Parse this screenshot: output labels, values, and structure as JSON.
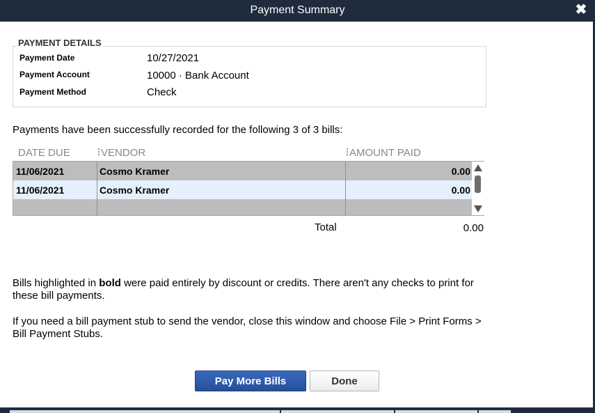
{
  "window": {
    "title": "Payment Summary",
    "close_glyph": "✖"
  },
  "details": {
    "section_title": "PAYMENT DETAILS",
    "rows": [
      {
        "label": "Payment Date",
        "value": "10/27/2021"
      },
      {
        "label": "Payment Account",
        "value": "10000 · Bank Account"
      },
      {
        "label": "Payment Method",
        "value": "Check"
      }
    ]
  },
  "message": "Payments have been successfully recorded for the following 3 of 3 bills:",
  "grid": {
    "headers": {
      "date_due": "DATE DUE",
      "vendor": "VENDOR",
      "amount_paid": "AMOUNT PAID"
    },
    "rows": [
      {
        "date_due": "11/06/2021",
        "vendor": "Cosmo Kramer",
        "amount_paid": "0.00"
      },
      {
        "date_due": "11/06/2021",
        "vendor": "Cosmo Kramer",
        "amount_paid": "0.00"
      }
    ]
  },
  "total": {
    "label": "Total",
    "value": "0.00"
  },
  "info": {
    "line1_prefix": "Bills highlighted in ",
    "line1_bold": "bold",
    "line1_suffix": " were paid entirely by discount or credits. There aren't any checks to print for these bill payments.",
    "line2": "If you need a bill payment stub to send the vendor, close this window and choose File > Print Forms > Bill Payment Stubs."
  },
  "buttons": {
    "pay_more_bills": "Pay More Bills",
    "done": "Done"
  },
  "icons": {
    "close": "close-icon",
    "scroll_up": "scroll-up-arrow-icon",
    "scroll_down": "scroll-down-arrow-icon",
    "column_separator": "column-resize-handle-icon"
  },
  "colors": {
    "titlebar": "#1e2c3e",
    "selected_row": "#e5f0fc",
    "row_gray": "#bdbdbd",
    "primary_button": "#2e5caa"
  }
}
